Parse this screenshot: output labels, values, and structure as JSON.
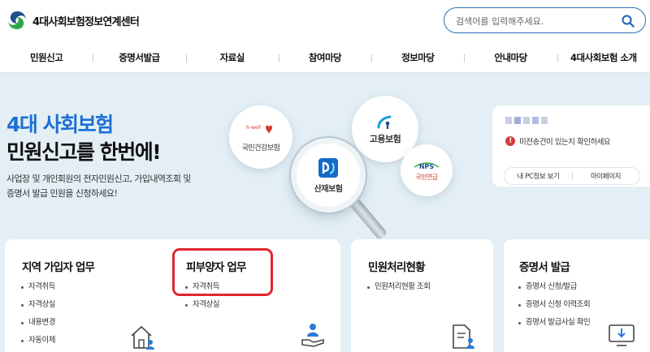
{
  "header": {
    "logo_text": "4대사회보험정보연계센터",
    "search": {
      "placeholder": "검색어를 입력해주세요."
    }
  },
  "nav": {
    "items": [
      "민원신고",
      "증명서발급",
      "자료실",
      "참여마당",
      "정보마당",
      "안내마당",
      "4대사회보험 소개"
    ]
  },
  "hero": {
    "title_line1": "4대 사회보험",
    "title_line2": "민원신고를 한번에!",
    "desc_line1": "사업장 및 개인회원의 전자민원신고, 가입내역조회 및",
    "desc_line2": "증명서 발급 민원을 신청하세요!",
    "bubbles": {
      "health_top": "h-well",
      "health_label": "국민건강보험",
      "employment_label": "고용보험",
      "nps_top": "NPS",
      "nps_label": "국민연금",
      "industrial_label": "산재보험"
    }
  },
  "login_card": {
    "alert_text": "미전송건이 있는지 확인하세요",
    "alert_mark": "!",
    "buttons": [
      "내 PC정보 보기",
      "마이페이지"
    ]
  },
  "cards": {
    "regional": {
      "title": "지역 가입자 업무",
      "items": [
        "자격취득",
        "자격상실",
        "내용변경",
        "자동이체"
      ]
    },
    "dependent": {
      "title": "피부양자 업무",
      "items": [
        "자격취득",
        "자격상실"
      ]
    },
    "status": {
      "title": "민원처리현황",
      "items": [
        "민원처리현황 조회"
      ]
    },
    "certificate": {
      "title": "증명서 발급",
      "items": [
        "증명서 신청/발급",
        "증명서 신청 이력조회",
        "증명서 발급사실 확인"
      ]
    }
  },
  "colors": {
    "brand_blue": "#1c6fd6",
    "highlight_red": "#e0262f",
    "background": "#e3eff5"
  }
}
